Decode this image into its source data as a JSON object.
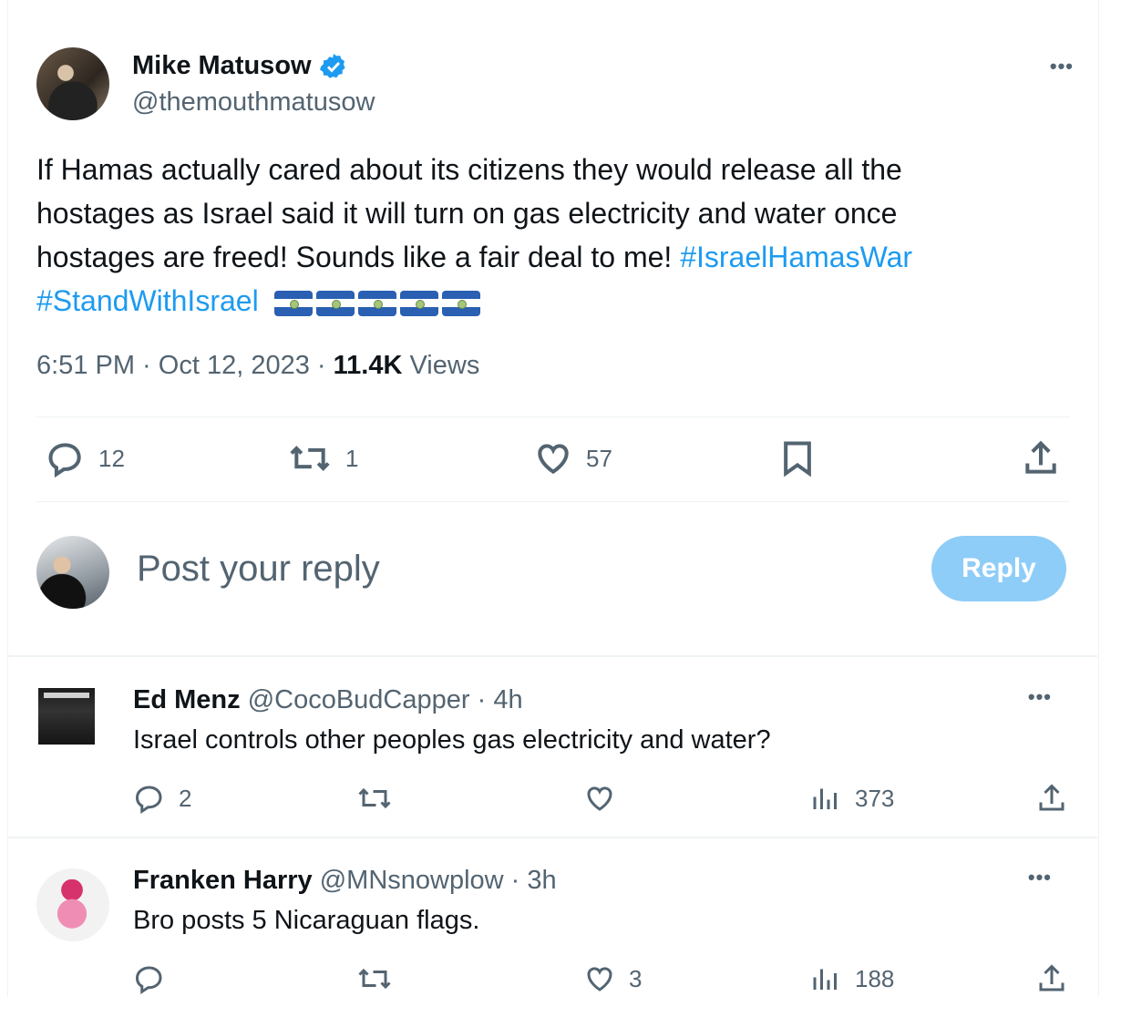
{
  "tweet": {
    "author_name": "Mike Matusow",
    "author_handle": "@themouthmatusow",
    "more": "•••",
    "text_plain": "If Hamas actually cared about its citizens they would release all the hostages as Israel said it will turn on gas electricity and water once hostages are freed! Sounds like a fair deal to me!",
    "hashtag_1": "#IsraelHamasWar",
    "hashtag_2": "#StandWithIsrael",
    "flag_count": 5,
    "time": "6:51 PM",
    "date": "Oct 12, 2023",
    "views_count": "11.4K",
    "views_label": "Views",
    "replies": "12",
    "reposts": "1",
    "likes": "57"
  },
  "composer": {
    "placeholder": "Post your reply",
    "button": "Reply"
  },
  "replies": [
    {
      "name": "Ed Menz",
      "handle": "@CocoBudCapper",
      "time": "4h",
      "text": "Israel controls other peoples gas electricity and water?",
      "replies": "2",
      "reposts": "",
      "likes": "",
      "views": "373"
    },
    {
      "name": "Franken Harry",
      "handle": "@MNsnowplow",
      "time": "3h",
      "text": "Bro posts 5 Nicaraguan flags.",
      "replies": "",
      "reposts": "",
      "likes": "3",
      "views": "188"
    }
  ],
  "colors": {
    "accent": "#1d9bf0",
    "muted": "#536471",
    "reply_button": "#8ecdf8"
  }
}
